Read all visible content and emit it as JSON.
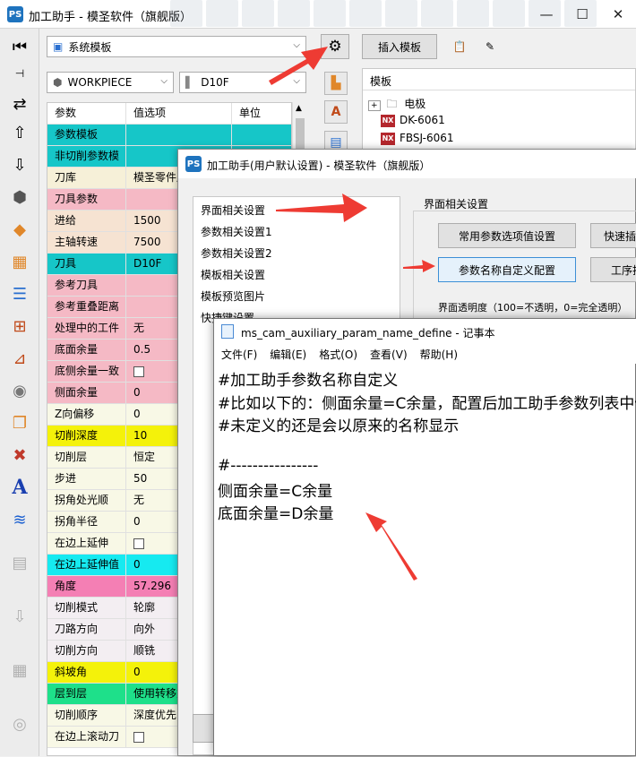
{
  "main": {
    "title": "加工助手 - 模圣软件（旗舰版）",
    "window_controls": {
      "minimize": "—",
      "maximize": "☐",
      "close": "✕"
    },
    "template_combo": "系统模板",
    "workpiece_combo": "WORKPIECE",
    "tool_combo": "D10F",
    "insert_template_button": "插入模板",
    "tree": {
      "header": "模板",
      "items": [
        {
          "label": "电极",
          "type": "folder"
        },
        {
          "label": "DK-6061",
          "type": "nx"
        },
        {
          "label": "FBSJ-6061",
          "type": "nx"
        }
      ],
      "nx_badge": "NX"
    },
    "param_table": {
      "headers": [
        "参数",
        "值选项",
        "单位"
      ],
      "rows": [
        {
          "name": "参数模板",
          "value": "",
          "unit": "",
          "color": "#16c6c8"
        },
        {
          "name": "非切削参数模",
          "value": "",
          "unit": "",
          "color": "#16c6c8"
        },
        {
          "name": "刀库",
          "value": "模圣零件库",
          "unit": "",
          "color": "#f6f0d8"
        },
        {
          "name": "刀具参数",
          "value": "",
          "unit": "",
          "color": "#f5b9c5"
        },
        {
          "name": "进给",
          "value": "1500",
          "unit": "",
          "color": "#f6e3d2"
        },
        {
          "name": "主轴转速",
          "value": "7500",
          "unit": "",
          "color": "#f6e3d2"
        },
        {
          "name": "刀具",
          "value": "D10F",
          "unit": "",
          "color": "#16c6c8"
        },
        {
          "name": "参考刀具",
          "value": "",
          "unit": "",
          "color": "#f5b9c5"
        },
        {
          "name": "参考重叠距离",
          "value": "",
          "unit": "",
          "color": "#f5b9c5"
        },
        {
          "name": "处理中的工件",
          "value": "无",
          "unit": "",
          "color": "#f5b9c5"
        },
        {
          "name": "底面余量",
          "value": "0.5",
          "unit": "",
          "color": "#f5b9c5"
        },
        {
          "name": "底侧余量一致",
          "value": "",
          "unit": "",
          "color": "#f5b9c5",
          "checkbox": true
        },
        {
          "name": "侧面余量",
          "value": "0",
          "unit": "",
          "color": "#f5b9c5"
        },
        {
          "name": "Z向偏移",
          "value": "0",
          "unit": "",
          "color": "#f8f8e6"
        },
        {
          "name": "切削深度",
          "value": "10",
          "unit": "",
          "color": "#f4f20a"
        },
        {
          "name": "切削层",
          "value": "恒定",
          "unit": "",
          "color": "#f8f8e6"
        },
        {
          "name": "步进",
          "value": "50",
          "unit": "",
          "color": "#f8f8e6"
        },
        {
          "name": "拐角处光顺",
          "value": "无",
          "unit": "",
          "color": "#f8f8e6"
        },
        {
          "name": "拐角半径",
          "value": "0",
          "unit": "",
          "color": "#f8f8e6"
        },
        {
          "name": "在边上延伸",
          "value": "",
          "unit": "",
          "color": "#f8f8e6",
          "checkbox": true
        },
        {
          "name": "在边上延伸值",
          "value": "0",
          "unit": "",
          "color": "#16eaf0"
        },
        {
          "name": "角度",
          "value": "57.296",
          "unit": "",
          "color": "#f47fb4"
        },
        {
          "name": "切削模式",
          "value": "轮廓",
          "unit": "",
          "color": "#f3eef2"
        },
        {
          "name": "刀路方向",
          "value": "向外",
          "unit": "",
          "color": "#f3eef2"
        },
        {
          "name": "切削方向",
          "value": "顺铣",
          "unit": "",
          "color": "#f3eef2"
        },
        {
          "name": "斜坡角",
          "value": "0",
          "unit": "",
          "color": "#f4f20a"
        },
        {
          "name": "层到层",
          "value": "使用转移方",
          "unit": "",
          "color": "#1ee08a"
        },
        {
          "name": "切削顺序",
          "value": "深度优先",
          "unit": "",
          "color": "#f8f8e6"
        },
        {
          "name": "在边上滚动刀",
          "value": "",
          "unit": "",
          "color": "#f8f8e6",
          "checkbox": true
        }
      ]
    }
  },
  "settings_dialog": {
    "title": "加工助手(用户默认设置) - 模圣软件（旗舰版）",
    "nav_items": [
      "界面相关设置",
      "参数相关设置1",
      "参数相关设置2",
      "模板相关设置",
      "模板预览图片",
      "快捷键设置"
    ],
    "group_title": "界面相关设置",
    "buttons": {
      "common_param": "常用参数选项值设置",
      "quick_insert": "快速插",
      "param_name_define": "参数名称自定义配置",
      "process": "工序排"
    },
    "transparency_label": "界面透明度（100=不透明，0=完全透明）"
  },
  "notepad": {
    "title": "ms_cam_auxiliary_param_name_define - 记事本",
    "menu": [
      "文件(F)",
      "编辑(E)",
      "格式(O)",
      "查看(V)",
      "帮助(H)"
    ],
    "lines": [
      "#加工助手参数名称自定义",
      "#比如以下的：侧面余量=C余量，配置后加工助手参数列表中侧面余量",
      "#未定义的还是会以原来的名称显示",
      "",
      "#----------------",
      "侧面余量=C余量",
      "底面余量=D余量"
    ]
  },
  "colors": {
    "arrow": "#ee3b33",
    "selected_button_border": "#3c8fd6"
  }
}
